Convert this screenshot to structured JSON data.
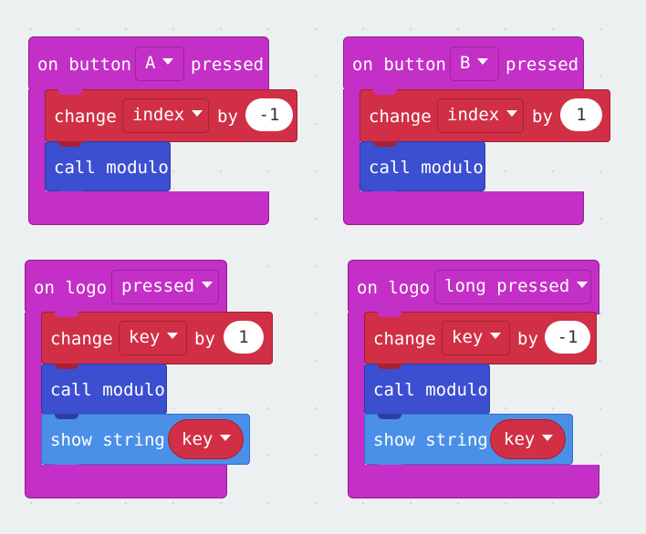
{
  "blocks": {
    "on_button_a": {
      "prefix": "on button",
      "button_value": "A",
      "suffix": "pressed",
      "change_label": "change",
      "var": "index",
      "by": "by",
      "amount": "-1",
      "call": "call modulo"
    },
    "on_button_b": {
      "prefix": "on button",
      "button_value": "B",
      "suffix": "pressed",
      "change_label": "change",
      "var": "index",
      "by": "by",
      "amount": "1",
      "call": "call modulo"
    },
    "on_logo_pressed": {
      "prefix": "on logo",
      "event": "pressed",
      "change_label": "change",
      "var": "key",
      "by": "by",
      "amount": "1",
      "call": "call modulo",
      "show": "show string",
      "show_var": "key"
    },
    "on_logo_long": {
      "prefix": "on logo",
      "event": "long pressed",
      "change_label": "change",
      "var": "key",
      "by": "by",
      "amount": "-1",
      "call": "call modulo",
      "show": "show string",
      "show_var": "key"
    }
  },
  "colors": {
    "event": "#c42fc7",
    "variable": "#d12f45",
    "function": "#3b4fd0",
    "basic": "#4a90e8",
    "workspace": "#ecf0f1"
  }
}
